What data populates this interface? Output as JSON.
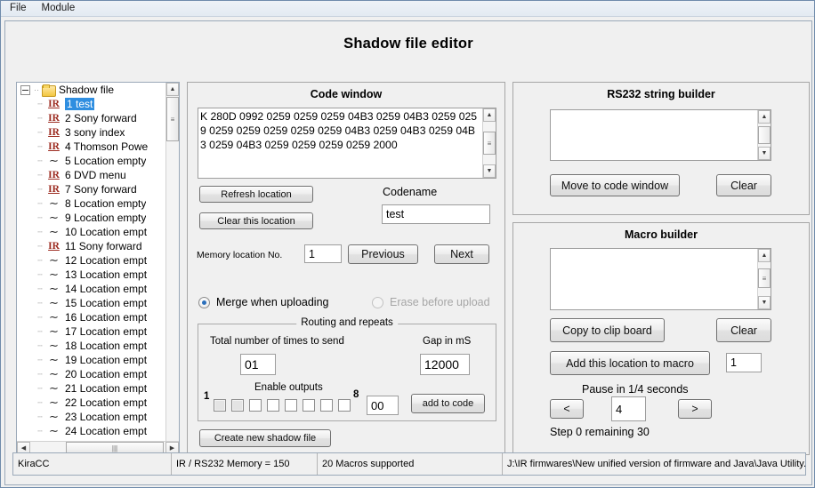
{
  "menubar": {
    "items": [
      {
        "label": "File"
      },
      {
        "label": "Module"
      }
    ]
  },
  "header": {
    "title": "Shadow file editor"
  },
  "tree": {
    "root": {
      "label": "Shadow file",
      "icon": "folder-icon"
    },
    "items": [
      {
        "icon": "ir-icon",
        "label": "1 test",
        "selected": true
      },
      {
        "icon": "ir-icon",
        "label": "2 Sony forward",
        "selected": false
      },
      {
        "icon": "ir-icon",
        "label": "3 sony index",
        "selected": false
      },
      {
        "icon": "ir-icon",
        "label": "4 Thomson Powe",
        "selected": false
      },
      {
        "icon": "tilde-icon",
        "label": "5 Location empty",
        "selected": false
      },
      {
        "icon": "ir-icon",
        "label": "6 DVD menu",
        "selected": false
      },
      {
        "icon": "ir-icon",
        "label": "7 Sony forward",
        "selected": false
      },
      {
        "icon": "tilde-icon",
        "label": "8 Location empty",
        "selected": false
      },
      {
        "icon": "tilde-icon",
        "label": "9 Location empty",
        "selected": false
      },
      {
        "icon": "tilde-icon",
        "label": "10 Location empt",
        "selected": false
      },
      {
        "icon": "ir-icon",
        "label": "11 Sony forward",
        "selected": false
      },
      {
        "icon": "tilde-icon",
        "label": "12 Location empt",
        "selected": false
      },
      {
        "icon": "tilde-icon",
        "label": "13 Location empt",
        "selected": false
      },
      {
        "icon": "tilde-icon",
        "label": "14 Location empt",
        "selected": false
      },
      {
        "icon": "tilde-icon",
        "label": "15 Location empt",
        "selected": false
      },
      {
        "icon": "tilde-icon",
        "label": "16 Location empt",
        "selected": false
      },
      {
        "icon": "tilde-icon",
        "label": "17 Location empt",
        "selected": false
      },
      {
        "icon": "tilde-icon",
        "label": "18 Location empt",
        "selected": false
      },
      {
        "icon": "tilde-icon",
        "label": "19 Location empt",
        "selected": false
      },
      {
        "icon": "tilde-icon",
        "label": "20 Location empt",
        "selected": false
      },
      {
        "icon": "tilde-icon",
        "label": "21 Location empt",
        "selected": false
      },
      {
        "icon": "tilde-icon",
        "label": "22 Location empt",
        "selected": false
      },
      {
        "icon": "tilde-icon",
        "label": "23 Location empt",
        "selected": false
      },
      {
        "icon": "tilde-icon",
        "label": "24 Location empt",
        "selected": false
      }
    ]
  },
  "code_window": {
    "title": "Code window",
    "code": "K 280D 0992 0259 0259 0259 04B3 0259 04B3 0259 0259 0259 0259 0259 0259 0259 04B3 0259 04B3 0259 04B3 0259 04B3 0259 0259 0259 0259 2000",
    "refresh_label": "Refresh location",
    "clear_label": "Clear this location",
    "codename_label": "Codename",
    "codename_value": "test",
    "memory_label": "Memory location No.",
    "memory_value": "1",
    "previous_label": "Previous",
    "next_label": "Next",
    "merge_label": "Merge when uploading",
    "merge_selected": true,
    "erase_label": "Erase before upload",
    "erase_selected": false,
    "erase_disabled": true,
    "create_label": "Create new shadow file"
  },
  "routing": {
    "legend": "Routing and repeats",
    "total_label": "Total number of times to send",
    "total_value": "01",
    "gap_label": "Gap in mS",
    "gap_value": "12000",
    "outputs_label": "Enable outputs",
    "first_index": "1",
    "last_index": "8",
    "outputs": [
      {
        "checked": false,
        "shaded": true
      },
      {
        "checked": false,
        "shaded": true
      },
      {
        "checked": false,
        "shaded": false
      },
      {
        "checked": false,
        "shaded": false
      },
      {
        "checked": false,
        "shaded": false
      },
      {
        "checked": false,
        "shaded": false
      },
      {
        "checked": false,
        "shaded": false
      },
      {
        "checked": false,
        "shaded": false
      }
    ],
    "outputs_value": "00",
    "add_to_code_label": "add to code"
  },
  "rs232": {
    "title": "RS232 string builder",
    "text": "",
    "move_label": "Move to code window",
    "clear_label": "Clear"
  },
  "macro": {
    "title": "Macro builder",
    "text": "",
    "copy_label": "Copy to clip board",
    "clear_label": "Clear",
    "add_location_label": "Add this location to macro",
    "location_value": "1",
    "pause_label": "Pause in 1/4 seconds",
    "prev_label": "<",
    "pause_value": "4",
    "next_label": ">",
    "step_status": "Step 0 remaining 30"
  },
  "statusbar": {
    "cells": [
      {
        "text": "KiraCC"
      },
      {
        "text": "IR / RS232 Memory = 150"
      },
      {
        "text": "20 Macros supported"
      },
      {
        "text": "J:\\IR firmwares\\New unified version of firmware and Java\\Java Utility..."
      }
    ]
  },
  "colors": {
    "accent": "#2f8ee0",
    "ir_red": "#9c2b20",
    "panel_bg": "#f0f0f0",
    "window_border": "#6f8bab"
  }
}
